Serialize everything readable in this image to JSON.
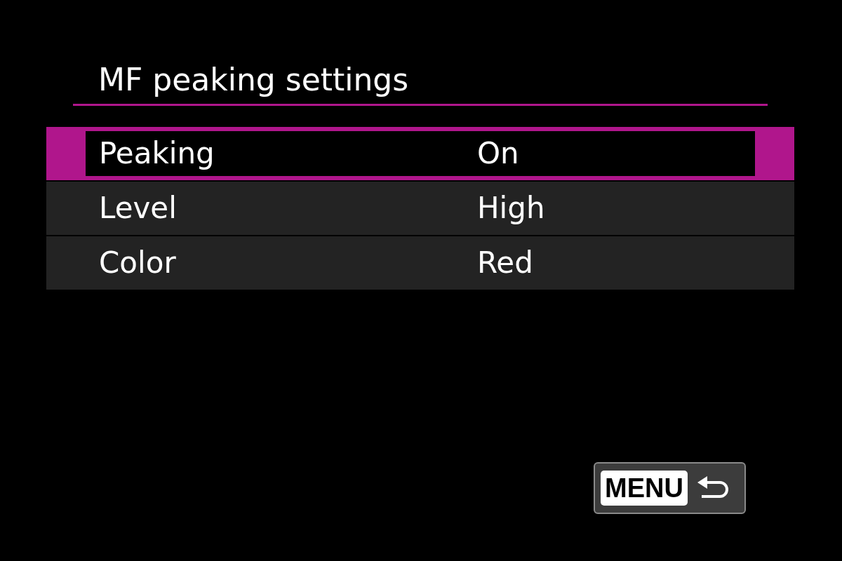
{
  "screen": {
    "title": "MF peaking settings"
  },
  "items": [
    {
      "label": "Peaking",
      "value": "On",
      "selected": true
    },
    {
      "label": "Level",
      "value": "High",
      "selected": false
    },
    {
      "label": "Color",
      "value": "Red",
      "selected": false
    }
  ],
  "back_button": {
    "label": "MENU"
  }
}
